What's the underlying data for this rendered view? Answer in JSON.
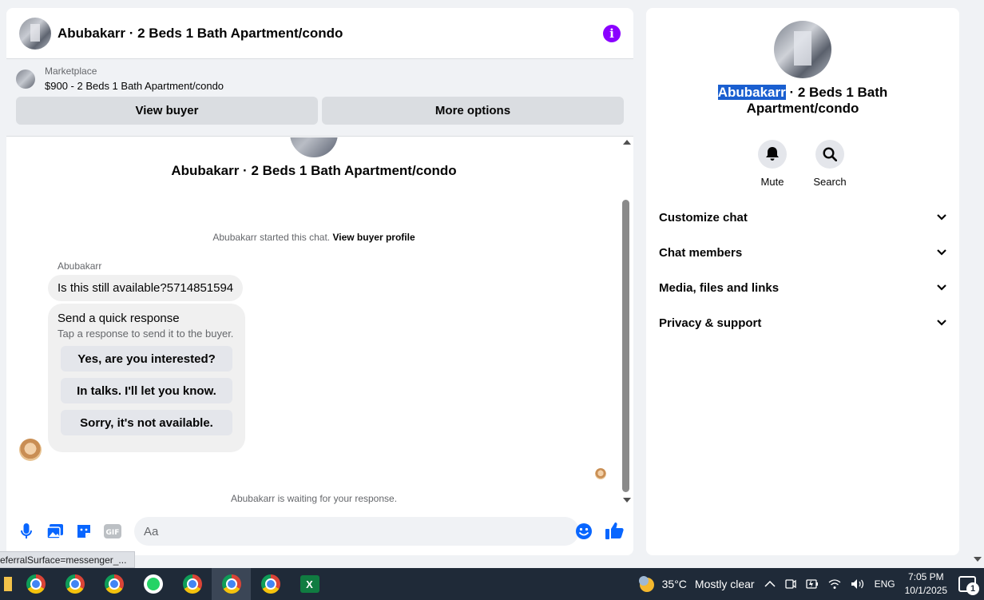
{
  "chat": {
    "title": "Abubakarr · 2 Beds 1 Bath Apartment/condo",
    "marketplace": {
      "label": "Marketplace",
      "item": "$900 - 2 Beds 1 Bath Apartment/condo",
      "view_buyer": "View buyer",
      "more_options": "More options"
    },
    "center_title": "Abubakarr · 2 Beds 1 Bath Apartment/condo",
    "started_text": "Abubakarr started this chat.",
    "view_buyer_profile": "View buyer profile",
    "sender_name": "Abubakarr",
    "message": "Is this still available?5714851594",
    "quick_response": {
      "title": "Send a quick response",
      "subtitle": "Tap a response to send it to the buyer.",
      "options": [
        "Yes, are you interested?",
        "In talks. I'll let you know.",
        "Sorry, it's not available."
      ]
    },
    "waiting_text": "Abubakarr is waiting for your response.",
    "composer_placeholder": "Aa"
  },
  "details": {
    "name_highlight": "Abubakarr",
    "title_rest": " · 2 Beds 1 Bath Apartment/condo",
    "actions": {
      "mute": "Mute",
      "search": "Search"
    },
    "sections": [
      "Customize chat",
      "Chat members",
      "Media, files and links",
      "Privacy & support"
    ]
  },
  "status_url": "eferralSurface=messenger_...",
  "taskbar": {
    "weather_temp": "35°C",
    "weather_text": "Mostly clear",
    "language": "ENG",
    "time": "7:05 PM",
    "date": "10/1/2025",
    "notification_count": "1",
    "excel_letter": "X"
  },
  "colors": {
    "accent": "#8a00ff",
    "like": "#0866ff",
    "taskbar": "#1f2a38"
  }
}
